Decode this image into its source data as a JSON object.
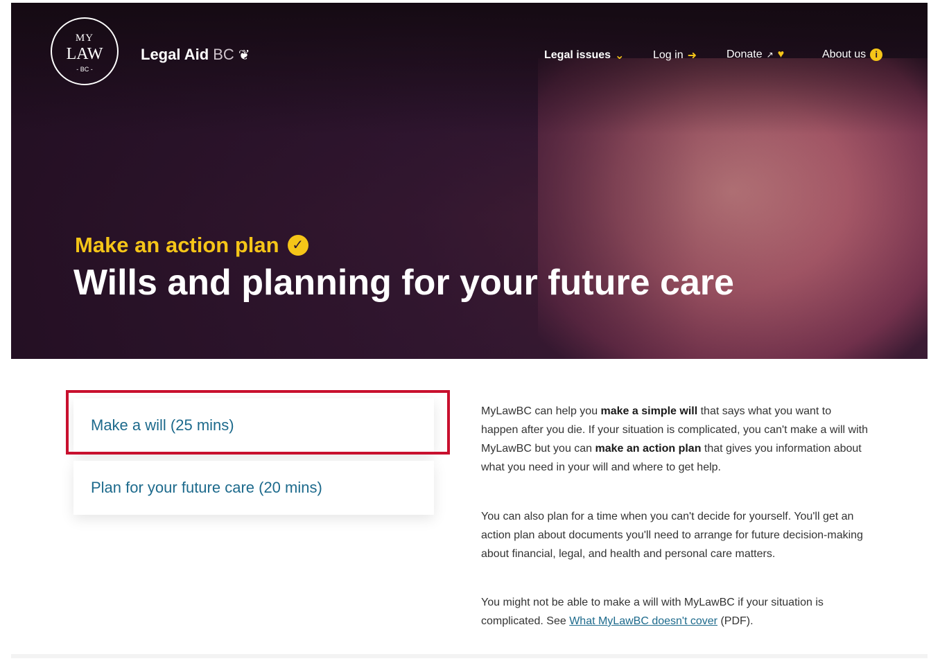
{
  "logo": {
    "line1": "MY",
    "line2": "LAW",
    "line3": "- BC -"
  },
  "brand": {
    "name": "Legal Aid",
    "suffix": "BC",
    "mark_icon": "hand-holding-person-icon"
  },
  "nav": {
    "legal_issues": "Legal issues",
    "log_in": "Log in",
    "donate": "Donate",
    "about_us": "About us"
  },
  "hero": {
    "kicker": "Make an action plan",
    "title": "Wills and planning for your future care"
  },
  "options": [
    {
      "label": "Make a will (25 mins)"
    },
    {
      "label": "Plan for your future care (20 mins)"
    }
  ],
  "content": {
    "p1": {
      "t1": "MyLawBC can help you ",
      "b1": "make a simple will",
      "t2": " that says what you want to happen after you die. If your situation is complicated, you can't make a will with MyLawBC but you can ",
      "b2": "make an action plan",
      "t3": " that gives you information about what you need in your will and where to get help."
    },
    "p2": "You can also plan for a time when you can't decide for yourself. You'll get an action plan about documents you'll need to arrange for future decision-making about financial, legal, and health and personal care matters.",
    "p3": {
      "t1": "You might not be able to make a will with MyLawBC if your situation is complicated. See ",
      "link": "What MyLawBC doesn't cover",
      "t2": " (PDF)."
    }
  },
  "colors": {
    "accent": "#f5c518",
    "link": "#1d6a8c",
    "highlight": "#c8102e"
  }
}
